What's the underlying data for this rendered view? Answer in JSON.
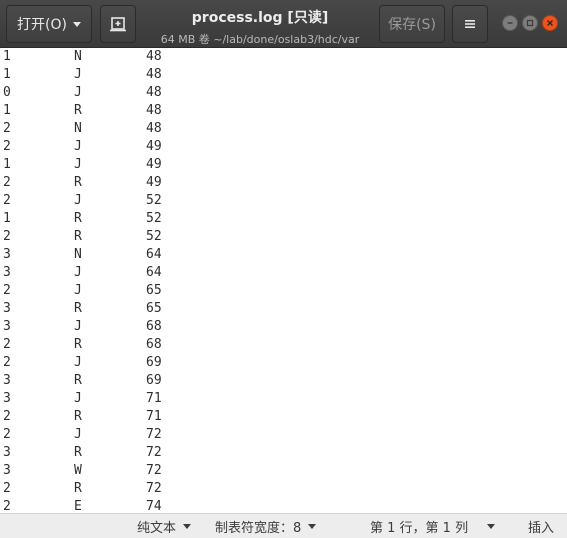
{
  "header": {
    "open_label": "打开(O)",
    "title": "process.log [只读]",
    "subtitle": "64 MB 卷 ~/lab/done/oslab3/hdc/var",
    "save_label": "保存(S)"
  },
  "lines": [
    [
      "1",
      "N",
      "48"
    ],
    [
      "1",
      "J",
      "48"
    ],
    [
      "0",
      "J",
      "48"
    ],
    [
      "1",
      "R",
      "48"
    ],
    [
      "2",
      "N",
      "48"
    ],
    [
      "2",
      "J",
      "49"
    ],
    [
      "1",
      "J",
      "49"
    ],
    [
      "2",
      "R",
      "49"
    ],
    [
      "2",
      "J",
      "52"
    ],
    [
      "1",
      "R",
      "52"
    ],
    [
      "2",
      "R",
      "52"
    ],
    [
      "3",
      "N",
      "64"
    ],
    [
      "3",
      "J",
      "64"
    ],
    [
      "2",
      "J",
      "65"
    ],
    [
      "3",
      "R",
      "65"
    ],
    [
      "3",
      "J",
      "68"
    ],
    [
      "2",
      "R",
      "68"
    ],
    [
      "2",
      "J",
      "69"
    ],
    [
      "3",
      "R",
      "69"
    ],
    [
      "3",
      "J",
      "71"
    ],
    [
      "2",
      "R",
      "71"
    ],
    [
      "2",
      "J",
      "72"
    ],
    [
      "3",
      "R",
      "72"
    ],
    [
      "3",
      "W",
      "72"
    ],
    [
      "2",
      "R",
      "72"
    ],
    [
      "2",
      "E",
      "74"
    ]
  ],
  "status": {
    "language": "纯文本",
    "tab_width": "制表符宽度：8",
    "position": "第 1 行，第 1 列",
    "mode": "插入"
  }
}
